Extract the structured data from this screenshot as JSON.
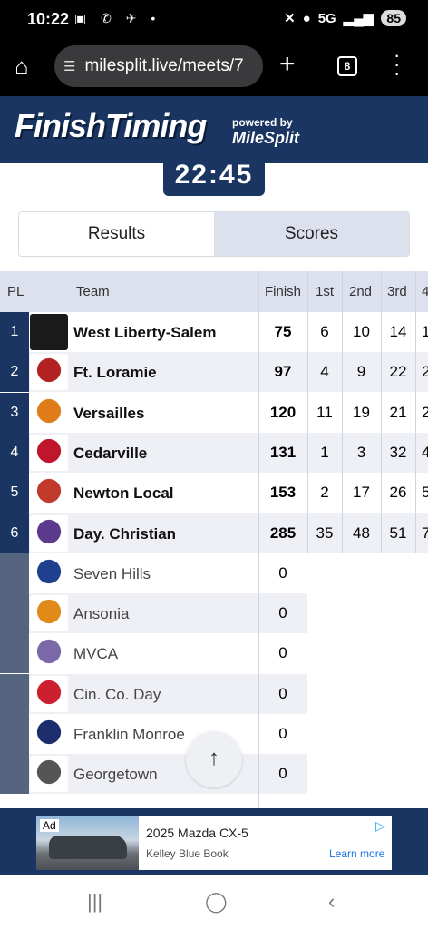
{
  "status": {
    "time": "10:22",
    "left_icons": [
      "gallery-icon",
      "photo-icon",
      "missed-call-icon",
      "dot-icon"
    ],
    "network": "5G",
    "battery": "85"
  },
  "browser": {
    "url": "milesplit.live/meets/7",
    "tab_count": "8"
  },
  "header": {
    "logo": "FinishTiming",
    "powered_by": "powered by",
    "brand": "MileSplit"
  },
  "clock": "22:45",
  "tabs": [
    "Results",
    "Scores"
  ],
  "table": {
    "columns": [
      "PL",
      "Team",
      "Finish",
      "1st",
      "2nd",
      "3rd",
      "4"
    ],
    "rows": [
      {
        "pl": "1",
        "team": "West Liberty-Salem",
        "finish": "75",
        "c1": "6",
        "c2": "10",
        "c3": "14",
        "c4": "1",
        "logo_color": "#1a1a1a"
      },
      {
        "pl": "2",
        "team": "Ft. Loramie",
        "finish": "97",
        "c1": "4",
        "c2": "9",
        "c3": "22",
        "c4": "2",
        "logo_color": "#b22222"
      },
      {
        "pl": "3",
        "team": "Versailles",
        "finish": "120",
        "c1": "11",
        "c2": "19",
        "c3": "21",
        "c4": "2",
        "logo_color": "#e07b1a"
      },
      {
        "pl": "4",
        "team": "Cedarville",
        "finish": "131",
        "c1": "1",
        "c2": "3",
        "c3": "32",
        "c4": "4",
        "logo_color": "#c0162c"
      },
      {
        "pl": "5",
        "team": "Newton Local",
        "finish": "153",
        "c1": "2",
        "c2": "17",
        "c3": "26",
        "c4": "5",
        "logo_color": "#c0392b"
      },
      {
        "pl": "6",
        "team": "Day. Christian",
        "finish": "285",
        "c1": "35",
        "c2": "48",
        "c3": "51",
        "c4": "7",
        "logo_color": "#5b3a8c"
      },
      {
        "pl": "",
        "team": "Seven Hills",
        "finish": "0",
        "logo_color": "#1f3f8f"
      },
      {
        "pl": "",
        "team": "Ansonia",
        "finish": "0",
        "logo_color": "#e08a1a"
      },
      {
        "pl": "",
        "team": "MVCA",
        "finish": "0",
        "logo_color": "#7b68a8"
      },
      {
        "pl": "",
        "team": "Cin. Co. Day",
        "finish": "0",
        "logo_color": "#cc1f2f"
      },
      {
        "pl": "",
        "team": "Franklin Monroe",
        "finish": "0",
        "logo_color": "#1d2d6b"
      },
      {
        "pl": "",
        "team": "Georgetown",
        "finish": "0",
        "logo_color": "#555555"
      }
    ]
  },
  "ad": {
    "tag": "Ad",
    "title": "2025 Mazda CX-5",
    "source": "Kelley Blue Book",
    "cta": "Learn more"
  },
  "colors": {
    "navy": "#1a3561",
    "pl_scored": "#1a3561",
    "pl_unscored": "#56657f",
    "row_alt": "#eef0f6",
    "header_bg": "#dde1ee"
  }
}
